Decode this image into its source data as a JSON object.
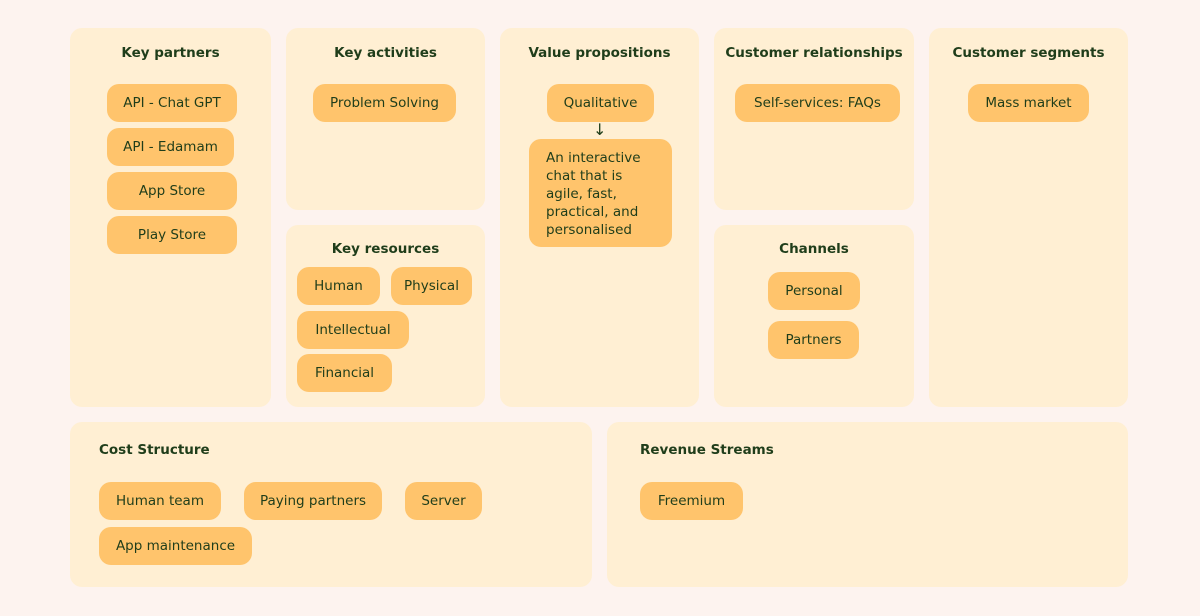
{
  "colors": {
    "background": "#fdf3ef",
    "card": "#ffefd3",
    "chip": "#ffc46c",
    "text": "#1f3d1a"
  },
  "key_partners": {
    "title": "Key partners",
    "items": [
      "API - Chat GPT",
      "API - Edamam",
      "App Store",
      "Play Store"
    ]
  },
  "key_activities": {
    "title": "Key activities",
    "items": [
      "Problem Solving"
    ]
  },
  "key_resources": {
    "title": "Key resources",
    "items": [
      "Human",
      "Physical",
      "Intellectual",
      "Financial"
    ]
  },
  "value_propositions": {
    "title": "Value propositions",
    "items": [
      "Qualitative"
    ],
    "detail": "An interactive chat that is agile, fast, practical, and personalised"
  },
  "customer_relationships": {
    "title": "Customer relationships",
    "items": [
      "Self-services: FAQs"
    ]
  },
  "channels": {
    "title": "Channels",
    "items": [
      "Personal",
      "Partners"
    ]
  },
  "customer_segments": {
    "title": "Customer segments",
    "items": [
      "Mass market"
    ]
  },
  "cost_structure": {
    "title": "Cost Structure",
    "items": [
      "Human team",
      "Paying partners",
      "Server",
      "App maintenance"
    ]
  },
  "revenue_streams": {
    "title": "Revenue Streams",
    "items": [
      "Freemium"
    ]
  }
}
